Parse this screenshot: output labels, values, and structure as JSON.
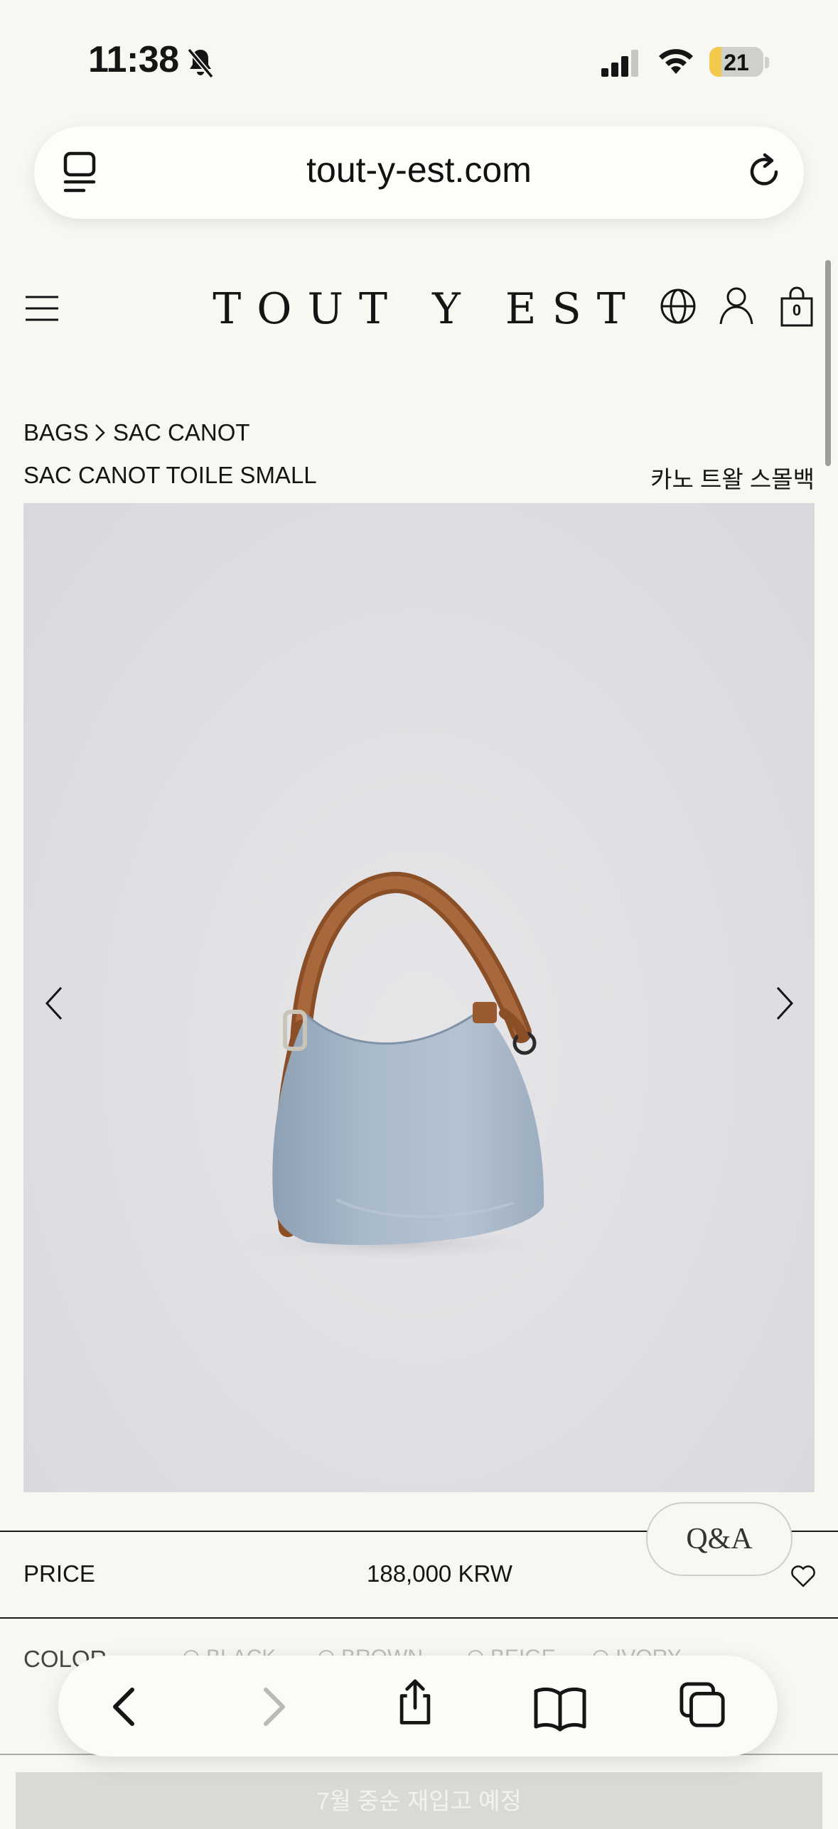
{
  "status_bar": {
    "time": "11:38",
    "battery_level": "21",
    "icons": [
      "bell-slash-icon",
      "cellular-signal-icon",
      "wifi-icon",
      "battery-icon"
    ]
  },
  "browser": {
    "url": "tout-y-est.com",
    "icons": [
      "reader-icon",
      "reload-icon"
    ]
  },
  "site_header": {
    "logo": "TOUT Y EST",
    "cart_count": "0",
    "icons": [
      "menu-icon",
      "globe-icon",
      "user-icon",
      "shopping-bag-icon"
    ]
  },
  "breadcrumb": {
    "items": [
      "BAGS",
      "SAC CANOT"
    ]
  },
  "product": {
    "name": "SAC CANOT TOILE SMALL",
    "name_ko": "카노 트왈 스몰백",
    "image_alt": "light blue canvas shoulder bag with brown leather strap",
    "price_label": "PRICE",
    "price": "188,000 KRW",
    "color_label": "COLOR",
    "color_options": [
      "BLACK",
      "BROWN",
      "BEIGE",
      "IVORY"
    ],
    "cta": "7월 중순 재입고 예정"
  },
  "qa_button": "Q&A",
  "colors": {
    "background": "#f8f7f2",
    "bag_body": "#a9bacb",
    "bag_strap": "#9a5a30"
  },
  "toolbar": {
    "icons": [
      "back-icon",
      "forward-icon",
      "share-icon",
      "bookmarks-icon",
      "tabs-icon"
    ]
  }
}
